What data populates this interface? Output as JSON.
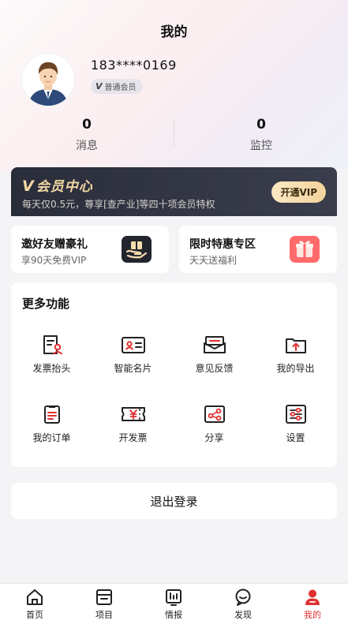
{
  "header": {
    "title": "我的"
  },
  "profile": {
    "phone": "183****0169",
    "level_badge": "普通会员",
    "level_mark": "V"
  },
  "stats": [
    {
      "value": "0",
      "label": "消息"
    },
    {
      "value": "0",
      "label": "监控"
    }
  ],
  "vip": {
    "mark": "V",
    "title": "会员中心",
    "desc": "每天仅0.5元，尊享[查产业]等四十项会员特权",
    "button": "开通VIP"
  },
  "promos": [
    {
      "title": "邀好友赠豪礼",
      "subtitle": "享90天免费VIP",
      "icon": "gift-hand-icon"
    },
    {
      "title": "限时特惠专区",
      "subtitle": "天天送福利",
      "icon": "gift-box-icon"
    }
  ],
  "more": {
    "title": "更多功能",
    "items": [
      {
        "label": "发票抬头",
        "icon": "invoice-header-icon"
      },
      {
        "label": "智能名片",
        "icon": "business-card-icon"
      },
      {
        "label": "意见反馈",
        "icon": "feedback-mail-icon"
      },
      {
        "label": "我的导出",
        "icon": "export-icon"
      },
      {
        "label": "我的订单",
        "icon": "order-list-icon"
      },
      {
        "label": "开发票",
        "icon": "issue-invoice-icon"
      },
      {
        "label": "分享",
        "icon": "share-icon"
      },
      {
        "label": "设置",
        "icon": "settings-sliders-icon"
      }
    ]
  },
  "logout": {
    "label": "退出登录"
  },
  "tabs": [
    {
      "label": "首页",
      "icon": "home-icon"
    },
    {
      "label": "项目",
      "icon": "project-icon"
    },
    {
      "label": "情报",
      "icon": "intel-icon"
    },
    {
      "label": "发现",
      "icon": "discover-icon"
    },
    {
      "label": "我的",
      "icon": "user-icon"
    }
  ],
  "colors": {
    "accent": "#e0302f",
    "vip_gold": "#f3d9a4",
    "vip_dark": "#2a2d3a"
  }
}
